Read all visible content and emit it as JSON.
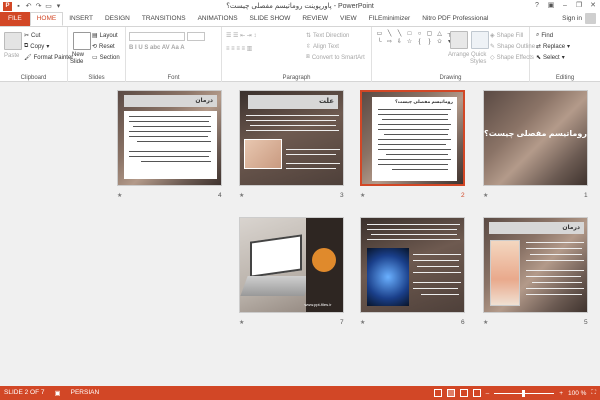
{
  "window": {
    "title": "پاورپوینت روماتیسم مفصلی چیست؟ - PowerPoint",
    "help": "?",
    "minimize": "–",
    "restore": "❐",
    "close": "✕"
  },
  "tabs": [
    {
      "label": "FILE",
      "kind": "file"
    },
    {
      "label": "HOME",
      "kind": "active"
    },
    {
      "label": "INSERT"
    },
    {
      "label": "DESIGN"
    },
    {
      "label": "TRANSITIONS"
    },
    {
      "label": "ANIMATIONS"
    },
    {
      "label": "SLIDE SHOW"
    },
    {
      "label": "REVIEW"
    },
    {
      "label": "VIEW"
    },
    {
      "label": "FILEminimizer"
    },
    {
      "label": "Nitro PDF Professional"
    }
  ],
  "signin": "Sign in",
  "ribbon": {
    "clipboard": {
      "paste": "Paste",
      "cut": "Cut",
      "copy": "Copy",
      "format_painter": "Format Painter",
      "label": "Clipboard"
    },
    "slides": {
      "new_slide": "New",
      "new_slide2": "Slide",
      "layout": "Layout",
      "reset": "Reset",
      "section": "Section",
      "label": "Slides"
    },
    "font": {
      "label": "Font"
    },
    "paragraph": {
      "text_direction": "Text Direction",
      "align_text": "Align Text",
      "convert": "Convert to SmartArt",
      "label": "Paragraph"
    },
    "drawing": {
      "arrange": "Arrange",
      "quick_styles": "Quick",
      "quick_styles2": "Styles",
      "shape_fill": "Shape Fill",
      "shape_outline": "Shape Outline",
      "shape_effects": "Shape Effects",
      "label": "Drawing"
    },
    "editing": {
      "find": "Find",
      "replace": "Replace",
      "select": "Select",
      "label": "Editing"
    }
  },
  "slides": [
    {
      "num": "1",
      "title": "روماتیسم مفصلی چیست؟"
    },
    {
      "num": "2",
      "title": "روماتیسم مفصلی چیست؟"
    },
    {
      "num": "3",
      "title": "علت"
    },
    {
      "num": "4",
      "title": "درمان"
    },
    {
      "num": "5",
      "title": "درمان"
    },
    {
      "num": "6",
      "title": ""
    },
    {
      "num": "7",
      "title": "www.ppt-files.ir"
    }
  ],
  "status": {
    "slide": "SLIDE 2 OF 7",
    "lang": "PERSIAN",
    "zoom": "100 %"
  },
  "colors": {
    "accent": "#d24726"
  }
}
